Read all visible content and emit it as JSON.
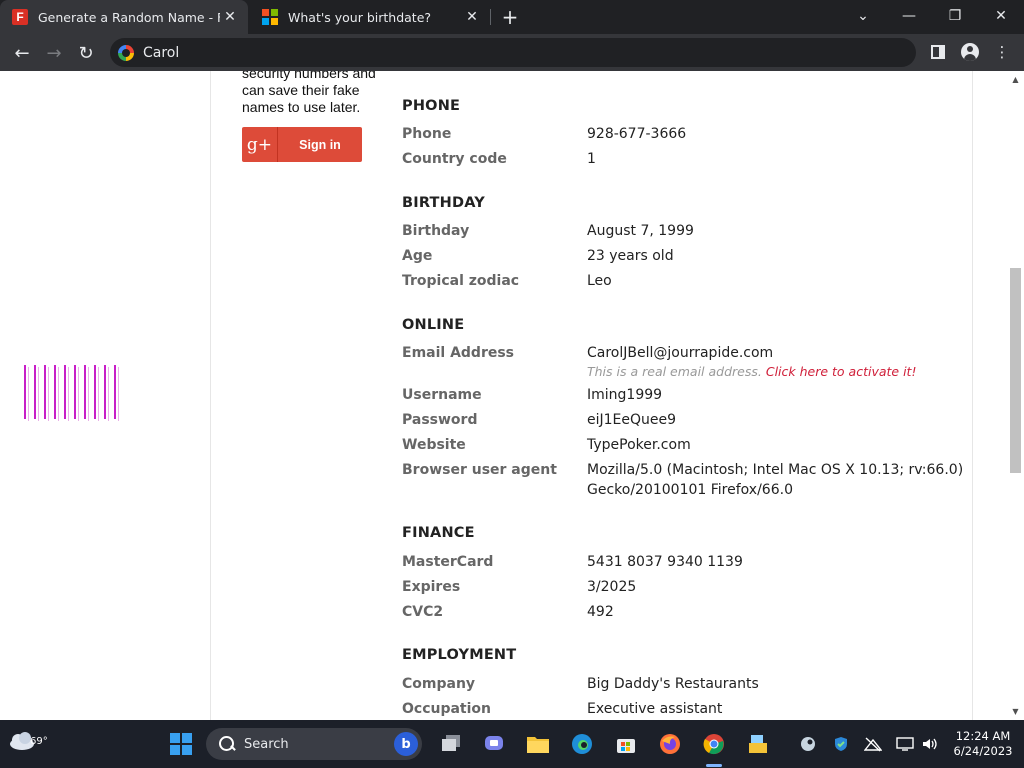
{
  "browser": {
    "tabs": [
      {
        "title": "Generate a Random Name - Fake",
        "active": true,
        "favicon": "fakenamegenerator-favicon"
      },
      {
        "title": "What's your birthdate?",
        "active": false,
        "favicon": "microsoft-favicon"
      }
    ],
    "address": "Carol"
  },
  "sidebar": {
    "text": "security numbers and can save their fake names to use later.",
    "signin_label": "Sign in",
    "gplus_glyph": "g+"
  },
  "sections": {
    "phone": {
      "heading": "PHONE",
      "rows": [
        {
          "label": "Phone",
          "value": "928-677-3666"
        },
        {
          "label": "Country code",
          "value": "1"
        }
      ]
    },
    "birthday": {
      "heading": "BIRTHDAY",
      "rows": [
        {
          "label": "Birthday",
          "value": "August 7, 1999"
        },
        {
          "label": "Age",
          "value": "23 years old"
        },
        {
          "label": "Tropical zodiac",
          "value": "Leo"
        }
      ]
    },
    "online": {
      "heading": "ONLINE",
      "email_label": "Email Address",
      "email_value": "CarolJBell@jourrapide.com",
      "email_note": "This is a real email address.",
      "email_activate": "Click here to activate it!",
      "rows": [
        {
          "label": "Username",
          "value": "Iming1999"
        },
        {
          "label": "Password",
          "value": "eiJ1EeQuee9"
        },
        {
          "label": "Website",
          "value": "TypePoker.com"
        }
      ],
      "ua_label": "Browser user agent",
      "ua_line1": "Mozilla/5.0 (Macintosh; Intel Mac OS X 10.13; rv:66.0)",
      "ua_line2": "Gecko/20100101 Firefox/66.0"
    },
    "finance": {
      "heading": "FINANCE",
      "rows": [
        {
          "label": "MasterCard",
          "value": "5431 8037 9340 1139"
        },
        {
          "label": "Expires",
          "value": "3/2025"
        },
        {
          "label": "CVC2",
          "value": "492"
        }
      ]
    },
    "employment": {
      "heading": "EMPLOYMENT",
      "rows": [
        {
          "label": "Company",
          "value": "Big Daddy's Restaurants"
        },
        {
          "label": "Occupation",
          "value": "Executive assistant"
        }
      ]
    }
  },
  "taskbar": {
    "temperature": "69°",
    "search_label": "Search",
    "time": "12:24 AM",
    "date": "6/24/2023"
  },
  "colors": {
    "accent_red": "#dd4b39",
    "activate_link": "#d0203a",
    "taskbar_bg": "#1c2029"
  }
}
